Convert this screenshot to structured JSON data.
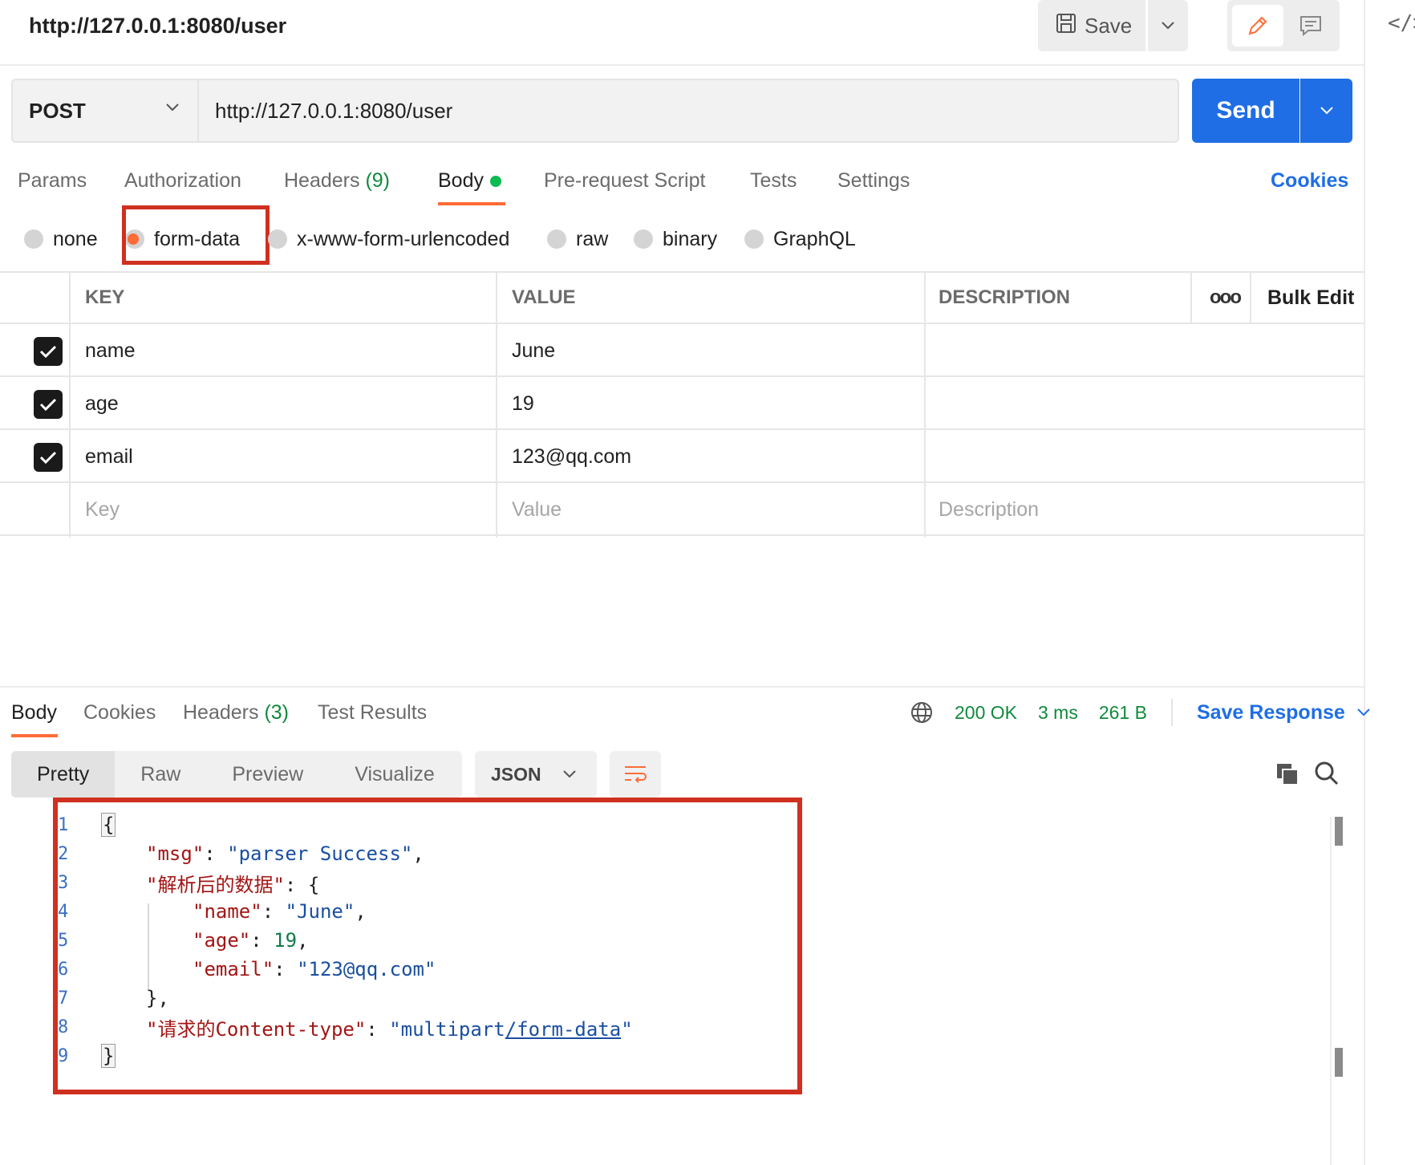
{
  "header": {
    "title": "http://127.0.0.1:8080/user",
    "save_label": "Save"
  },
  "request": {
    "method": "POST",
    "url": "http://127.0.0.1:8080/user",
    "send_label": "Send"
  },
  "req_tabs": {
    "params": "Params",
    "authorization": "Authorization",
    "headers": "Headers",
    "headers_count": "(9)",
    "body": "Body",
    "prerequest": "Pre-request Script",
    "tests": "Tests",
    "settings": "Settings",
    "cookies": "Cookies"
  },
  "body_types": {
    "none": "none",
    "form_data": "form-data",
    "urlencoded": "x-www-form-urlencoded",
    "raw": "raw",
    "binary": "binary",
    "graphql": "GraphQL",
    "selected": "form-data"
  },
  "params_table": {
    "headers": {
      "key": "KEY",
      "value": "VALUE",
      "description": "DESCRIPTION",
      "bulk_edit": "Bulk Edit",
      "more": "ooo"
    },
    "rows": [
      {
        "key": "name",
        "value": "June",
        "description": "",
        "checked": true
      },
      {
        "key": "age",
        "value": "19",
        "description": "",
        "checked": true
      },
      {
        "key": "email",
        "value": "123@qq.com",
        "description": "",
        "checked": true
      }
    ],
    "placeholder": {
      "key": "Key",
      "value": "Value",
      "description": "Description"
    }
  },
  "response": {
    "tabs": {
      "body": "Body",
      "cookies": "Cookies",
      "headers": "Headers",
      "headers_count": "(3)",
      "test_results": "Test Results"
    },
    "status": "200 OK",
    "time": "3 ms",
    "size": "261 B",
    "save_response": "Save Response",
    "format_tabs": {
      "pretty": "Pretty",
      "raw": "Raw",
      "preview": "Preview",
      "visualize": "Visualize"
    },
    "language": "JSON"
  },
  "code": {
    "line_numbers": [
      "1",
      "2",
      "3",
      "4",
      "5",
      "6",
      "7",
      "8",
      "9"
    ],
    "open_brace": "{",
    "close_brace": "}",
    "msg_key": "\"msg\"",
    "msg_value": "\"parser Success\"",
    "data_key": "\"解析后的数据\"",
    "name_key": "\"name\"",
    "name_value": "\"June\"",
    "age_key": "\"age\"",
    "age_value": "19",
    "email_key": "\"email\"",
    "email_value": "\"123@qq.com\"",
    "ct_key": "\"请求的Content-type\"",
    "ct_value_pre": "\"multipart",
    "ct_value_link": "/form-data",
    "ct_value_post": "\"",
    "colon": ": ",
    "comma": ",",
    "inner_open": "{",
    "inner_close": "},"
  },
  "colors": {
    "accent": "#ff6c37",
    "primary": "#1f6ee5",
    "success": "#0f8a3c",
    "highlight": "#d0301f"
  }
}
